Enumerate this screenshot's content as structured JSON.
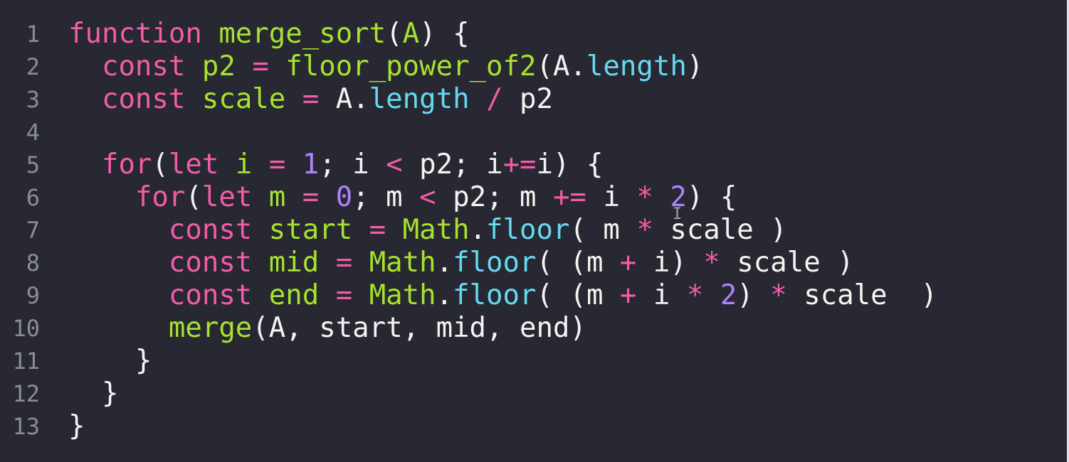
{
  "editor": {
    "language": "javascript",
    "colors": {
      "background": "#272832",
      "line_number": "#8b8d95",
      "plain": "#f4f4f2",
      "keyword": "#f25ca8",
      "definition": "#a6e22e",
      "property": "#66d9ef",
      "number": "#ae81ff"
    },
    "lines": [
      {
        "number": "1",
        "tokens": [
          {
            "t": "function",
            "c": "keyword"
          },
          {
            "t": " ",
            "c": "plain"
          },
          {
            "t": "merge_sort",
            "c": "definition"
          },
          {
            "t": "(",
            "c": "plain"
          },
          {
            "t": "A",
            "c": "definition"
          },
          {
            "t": ") {",
            "c": "plain"
          }
        ]
      },
      {
        "number": "2",
        "tokens": [
          {
            "t": "  ",
            "c": "plain"
          },
          {
            "t": "const",
            "c": "keyword"
          },
          {
            "t": " ",
            "c": "plain"
          },
          {
            "t": "p2",
            "c": "definition"
          },
          {
            "t": " ",
            "c": "plain"
          },
          {
            "t": "=",
            "c": "keyword"
          },
          {
            "t": " ",
            "c": "plain"
          },
          {
            "t": "floor_power_of2",
            "c": "definition"
          },
          {
            "t": "(A.",
            "c": "plain"
          },
          {
            "t": "length",
            "c": "property"
          },
          {
            "t": ")",
            "c": "plain"
          }
        ]
      },
      {
        "number": "3",
        "tokens": [
          {
            "t": "  ",
            "c": "plain"
          },
          {
            "t": "const",
            "c": "keyword"
          },
          {
            "t": " ",
            "c": "plain"
          },
          {
            "t": "scale",
            "c": "definition"
          },
          {
            "t": " ",
            "c": "plain"
          },
          {
            "t": "=",
            "c": "keyword"
          },
          {
            "t": " A.",
            "c": "plain"
          },
          {
            "t": "length",
            "c": "property"
          },
          {
            "t": " ",
            "c": "plain"
          },
          {
            "t": "/",
            "c": "keyword"
          },
          {
            "t": " p2",
            "c": "plain"
          }
        ]
      },
      {
        "number": "4",
        "tokens": []
      },
      {
        "number": "5",
        "tokens": [
          {
            "t": "  ",
            "c": "plain"
          },
          {
            "t": "for",
            "c": "keyword"
          },
          {
            "t": "(",
            "c": "plain"
          },
          {
            "t": "let",
            "c": "keyword"
          },
          {
            "t": " ",
            "c": "plain"
          },
          {
            "t": "i",
            "c": "definition"
          },
          {
            "t": " ",
            "c": "plain"
          },
          {
            "t": "=",
            "c": "keyword"
          },
          {
            "t": " ",
            "c": "plain"
          },
          {
            "t": "1",
            "c": "number"
          },
          {
            "t": "; i ",
            "c": "plain"
          },
          {
            "t": "<",
            "c": "keyword"
          },
          {
            "t": " p2; i",
            "c": "plain"
          },
          {
            "t": "+=",
            "c": "keyword"
          },
          {
            "t": "i) {",
            "c": "plain"
          }
        ]
      },
      {
        "number": "6",
        "tokens": [
          {
            "t": "    ",
            "c": "plain"
          },
          {
            "t": "for",
            "c": "keyword"
          },
          {
            "t": "(",
            "c": "plain"
          },
          {
            "t": "let",
            "c": "keyword"
          },
          {
            "t": " ",
            "c": "plain"
          },
          {
            "t": "m",
            "c": "definition"
          },
          {
            "t": " ",
            "c": "plain"
          },
          {
            "t": "=",
            "c": "keyword"
          },
          {
            "t": " ",
            "c": "plain"
          },
          {
            "t": "0",
            "c": "number"
          },
          {
            "t": "; m ",
            "c": "plain"
          },
          {
            "t": "<",
            "c": "keyword"
          },
          {
            "t": " p2; m ",
            "c": "plain"
          },
          {
            "t": "+=",
            "c": "keyword"
          },
          {
            "t": " i ",
            "c": "plain"
          },
          {
            "t": "*",
            "c": "keyword"
          },
          {
            "t": " ",
            "c": "plain"
          },
          {
            "t": "2",
            "c": "number"
          },
          {
            "t": ") {",
            "c": "plain"
          }
        ]
      },
      {
        "number": "7",
        "tokens": [
          {
            "t": "      ",
            "c": "plain"
          },
          {
            "t": "const",
            "c": "keyword"
          },
          {
            "t": " ",
            "c": "plain"
          },
          {
            "t": "start",
            "c": "definition"
          },
          {
            "t": " ",
            "c": "plain"
          },
          {
            "t": "=",
            "c": "keyword"
          },
          {
            "t": " ",
            "c": "plain"
          },
          {
            "t": "Math",
            "c": "definition"
          },
          {
            "t": ".",
            "c": "plain"
          },
          {
            "t": "floor",
            "c": "property"
          },
          {
            "t": "( m ",
            "c": "plain"
          },
          {
            "t": "*",
            "c": "keyword"
          },
          {
            "t": " scale )",
            "c": "plain"
          }
        ]
      },
      {
        "number": "8",
        "tokens": [
          {
            "t": "      ",
            "c": "plain"
          },
          {
            "t": "const",
            "c": "keyword"
          },
          {
            "t": " ",
            "c": "plain"
          },
          {
            "t": "mid",
            "c": "definition"
          },
          {
            "t": " ",
            "c": "plain"
          },
          {
            "t": "=",
            "c": "keyword"
          },
          {
            "t": " ",
            "c": "plain"
          },
          {
            "t": "Math",
            "c": "definition"
          },
          {
            "t": ".",
            "c": "plain"
          },
          {
            "t": "floor",
            "c": "property"
          },
          {
            "t": "( (m ",
            "c": "plain"
          },
          {
            "t": "+",
            "c": "keyword"
          },
          {
            "t": " i) ",
            "c": "plain"
          },
          {
            "t": "*",
            "c": "keyword"
          },
          {
            "t": " scale )",
            "c": "plain"
          }
        ]
      },
      {
        "number": "9",
        "tokens": [
          {
            "t": "      ",
            "c": "plain"
          },
          {
            "t": "const",
            "c": "keyword"
          },
          {
            "t": " ",
            "c": "plain"
          },
          {
            "t": "end",
            "c": "definition"
          },
          {
            "t": " ",
            "c": "plain"
          },
          {
            "t": "=",
            "c": "keyword"
          },
          {
            "t": " ",
            "c": "plain"
          },
          {
            "t": "Math",
            "c": "definition"
          },
          {
            "t": ".",
            "c": "plain"
          },
          {
            "t": "floor",
            "c": "property"
          },
          {
            "t": "( (m ",
            "c": "plain"
          },
          {
            "t": "+",
            "c": "keyword"
          },
          {
            "t": " i ",
            "c": "plain"
          },
          {
            "t": "*",
            "c": "keyword"
          },
          {
            "t": " ",
            "c": "plain"
          },
          {
            "t": "2",
            "c": "number"
          },
          {
            "t": ") ",
            "c": "plain"
          },
          {
            "t": "*",
            "c": "keyword"
          },
          {
            "t": " scale  )",
            "c": "plain"
          }
        ]
      },
      {
        "number": "10",
        "tokens": [
          {
            "t": "      ",
            "c": "plain"
          },
          {
            "t": "merge",
            "c": "definition"
          },
          {
            "t": "(A, start, mid, end)",
            "c": "plain"
          }
        ]
      },
      {
        "number": "11",
        "tokens": [
          {
            "t": "    }",
            "c": "plain"
          }
        ]
      },
      {
        "number": "12",
        "tokens": [
          {
            "t": "  }",
            "c": "plain"
          }
        ]
      },
      {
        "number": "13",
        "tokens": [
          {
            "t": "}",
            "c": "plain"
          }
        ]
      }
    ]
  },
  "text_cursor": {
    "glyph": "I",
    "icon": "i-beam-icon"
  }
}
